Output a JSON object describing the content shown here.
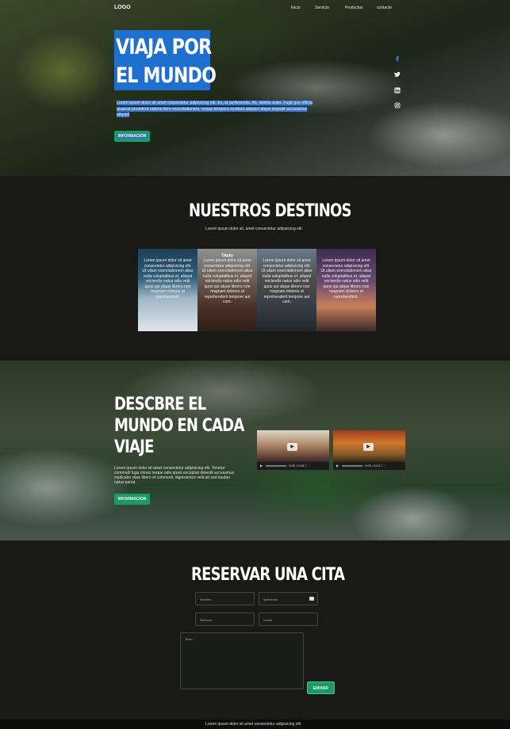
{
  "nav": {
    "logo": "LOGO",
    "links": [
      "Inicio",
      "Servicio",
      "Productos",
      "contacto"
    ]
  },
  "hero": {
    "title_line1": "VIAJA POR",
    "title_line2": "EL MUNDO",
    "text": "Lorem ipsum dolor sit amet consectetur adipisicing elit. Ex, id perferendis. Ab, debitis anim. Fugit quo officia quaerat provident ratione libre exercitationem, neque tempora incidunt adipisci atque impedit accusamus aliquid!",
    "button": "INFORMACION",
    "social_icons": [
      "facebook-icon",
      "twitter-icon",
      "linkedin-icon",
      "instagram-icon"
    ]
  },
  "destinos": {
    "title": "NUESTROS DESTINOS",
    "subtitle": "Lorem ipsum dolor sit, amet consectetur adipisicing elit.",
    "cards": [
      {
        "text": "Lorem ipsum dolor sit amet consectetur adipisicing elit. Ut ullam exercitationem alias nulla voluptatibus et, aliquid reiciendis natus odio velit quos qui atque librero non magnam dolores ut reprehenderit."
      },
      {
        "heading": "Titulo",
        "text": "Lorem ipsum dolor sit amet consectetur adipisicing elit. Ut ullam exercitationem alias nulla voluptatibus et, aliquid reiciendis natus odio velit quos qui atque librero non magnam dolores ut reprehenderit tempore aut cum."
      },
      {
        "text": "Lorem ipsum dolor sit amet consectetur adipisicing elit. Ut ullam exercitationem alias nulla voluptatibus et, aliquid reiciendis natus odio velit quos qui atque librero non magnam dolores ut reprehenderit tempore aut cum."
      },
      {
        "text": "Lorem ipsum dolor sit amet consectetur adipisicing elit. Ut ullam exercitationem alias nulla voluptatibus et, aliquid reiciendis natus odio velit quos qui atque librero non magnam dolores ut reprehenderit."
      }
    ]
  },
  "descubre": {
    "title_lines": [
      "DESCBRE EL",
      "MUNDO EN CADA",
      "VIAJE"
    ],
    "text": "Lorem ipsum dolor sit amet consectetur adipisicing elit. Tenetur commodi fuga minus neque odio quasi excepturi deleniti accusamus explicabo vitae libero et commodi, dignissimos velit ad sed laudan natus pariat.",
    "button": "INFORMACION",
    "videos": [
      {
        "time": "0:00 / 0:18"
      },
      {
        "time": "0:00 / 0:14"
      }
    ]
  },
  "reservar": {
    "title": "RESERVAR UNA CITA",
    "fields": {
      "nombre": "Nombre",
      "fecha": "dd/mm/aa",
      "telefono": "Telefono",
      "correo": "correo"
    },
    "message": "Texto",
    "button": "ENVIAR"
  },
  "footer": {
    "text": "Lorem ipsum dolor sit amet consectetur adipisicing elit"
  }
}
